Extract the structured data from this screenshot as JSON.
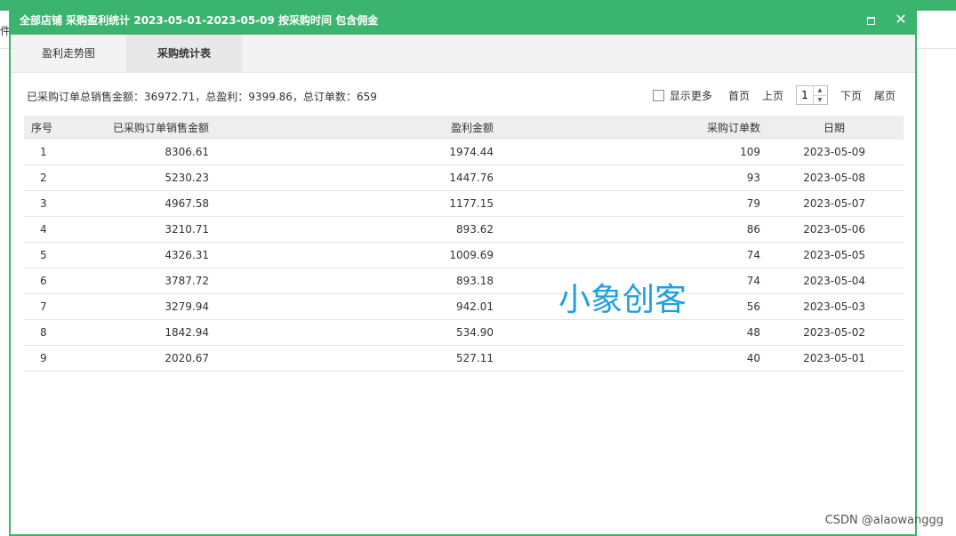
{
  "background": {
    "partial_text": "件"
  },
  "dialog": {
    "title": "全部店铺 采购盈利统计 2023-05-01-2023-05-09 按采购时间 包含佣金",
    "tabs": [
      {
        "label": "盈利走势图",
        "active": false
      },
      {
        "label": "采购统计表",
        "active": true
      }
    ],
    "summary": {
      "sales_label": "已采购订单总销售金额：",
      "sales_value": "36972.71",
      "profit_label": "，总盈利：",
      "profit_value": "9399.86",
      "orders_label": "，总订单数：",
      "orders_value": "659"
    },
    "pager": {
      "show_more_label": "显示更多",
      "show_more_checked": false,
      "first": "首页",
      "prev": "上页",
      "page": "1",
      "next": "下页",
      "last": "尾页"
    },
    "table": {
      "columns": [
        "序号",
        "已采购订单销售金额",
        "盈利金额",
        "采购订单数",
        "日期"
      ],
      "rows": [
        [
          "1",
          "8306.61",
          "1974.44",
          "109",
          "2023-05-09"
        ],
        [
          "2",
          "5230.23",
          "1447.76",
          "93",
          "2023-05-08"
        ],
        [
          "3",
          "4967.58",
          "1177.15",
          "79",
          "2023-05-07"
        ],
        [
          "4",
          "3210.71",
          "893.62",
          "86",
          "2023-05-06"
        ],
        [
          "5",
          "4326.31",
          "1009.69",
          "74",
          "2023-05-05"
        ],
        [
          "6",
          "3787.72",
          "893.18",
          "74",
          "2023-05-04"
        ],
        [
          "7",
          "3279.94",
          "942.01",
          "56",
          "2023-05-03"
        ],
        [
          "8",
          "1842.94",
          "534.90",
          "48",
          "2023-05-02"
        ],
        [
          "9",
          "2020.67",
          "527.11",
          "40",
          "2023-05-01"
        ]
      ]
    }
  },
  "watermark": "小象创客",
  "csdn_watermark": "CSDN @alaowanggg",
  "colors": {
    "accent": "#3ab46e",
    "watermark": "#1d9fe6"
  }
}
